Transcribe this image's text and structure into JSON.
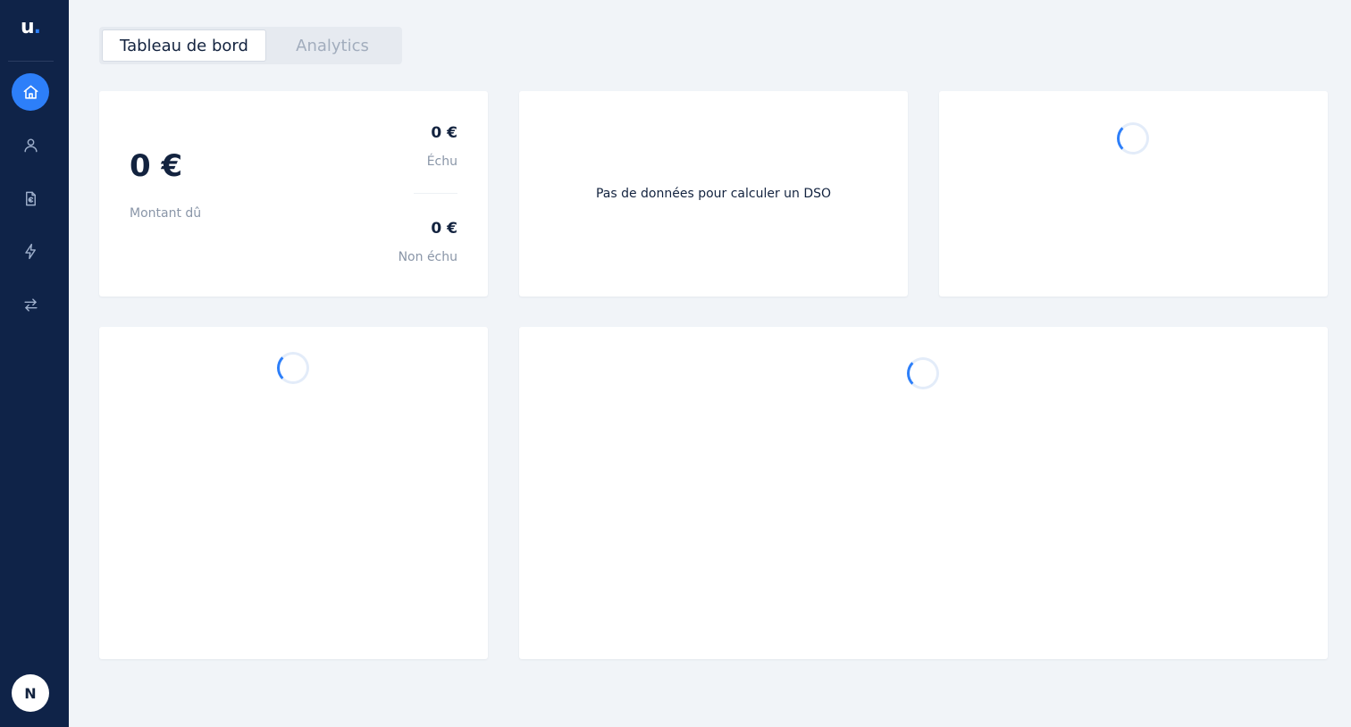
{
  "sidebar": {
    "logo_text": "u",
    "logo_dot": ".",
    "items": [
      {
        "name": "home",
        "icon": "home-icon",
        "active": true
      },
      {
        "name": "user",
        "icon": "user-icon",
        "active": false
      },
      {
        "name": "invoices",
        "icon": "file-euro-icon",
        "active": false
      },
      {
        "name": "automations",
        "icon": "lightning-icon",
        "active": false
      },
      {
        "name": "transfers",
        "icon": "arrows-exchange-icon",
        "active": false
      }
    ],
    "avatar_initial": "N"
  },
  "tabs": [
    {
      "label": "Tableau de bord",
      "active": true
    },
    {
      "label": "Analytics",
      "active": false
    }
  ],
  "summary_card": {
    "amount_due": "0 €",
    "amount_due_label": "Montant dû",
    "overdue_amount": "0 €",
    "overdue_label": "Échu",
    "not_overdue_amount": "0 €",
    "not_overdue_label": "Non échu"
  },
  "dso_card": {
    "message": "Pas de données pour calculer un DSO"
  },
  "colors": {
    "sidebar_bg": "#0f2348",
    "accent": "#2d7ff9",
    "page_bg": "#f1f4f8"
  }
}
